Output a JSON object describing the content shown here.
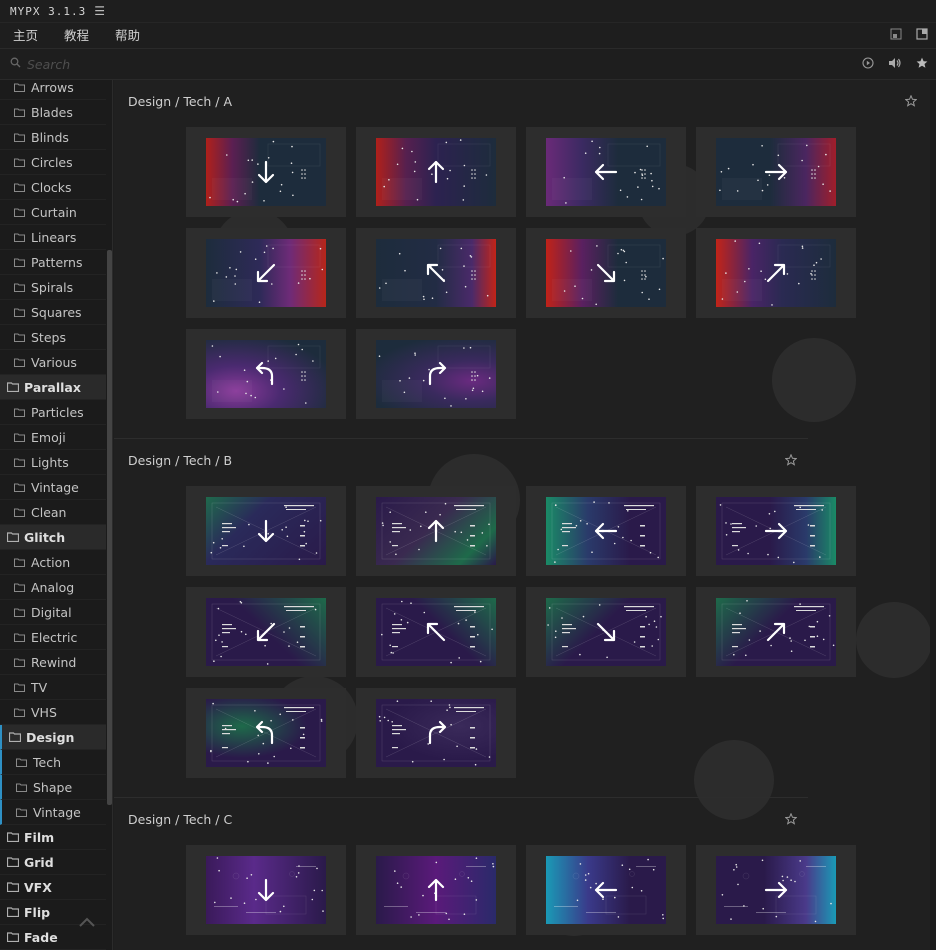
{
  "app": {
    "title": "MYPX 3.1.3"
  },
  "menu": {
    "items": [
      "主页",
      "教程",
      "帮助"
    ]
  },
  "search": {
    "placeholder": "Search",
    "value": ""
  },
  "sidebar": {
    "rows": [
      {
        "label": "Arrows",
        "type": "sub"
      },
      {
        "label": "Blades",
        "type": "sub"
      },
      {
        "label": "Blinds",
        "type": "sub"
      },
      {
        "label": "Circles",
        "type": "sub"
      },
      {
        "label": "Clocks",
        "type": "sub"
      },
      {
        "label": "Curtain",
        "type": "sub"
      },
      {
        "label": "Linears",
        "type": "sub"
      },
      {
        "label": "Patterns",
        "type": "sub"
      },
      {
        "label": "Spirals",
        "type": "sub"
      },
      {
        "label": "Squares",
        "type": "sub"
      },
      {
        "label": "Steps",
        "type": "sub"
      },
      {
        "label": "Various",
        "type": "sub"
      },
      {
        "label": "Parallax",
        "type": "cat",
        "open": true
      },
      {
        "label": "Particles",
        "type": "sub"
      },
      {
        "label": "Emoji",
        "type": "sub"
      },
      {
        "label": "Lights",
        "type": "sub"
      },
      {
        "label": "Vintage",
        "type": "sub"
      },
      {
        "label": "Clean",
        "type": "sub"
      },
      {
        "label": "Glitch",
        "type": "cat",
        "open": true
      },
      {
        "label": "Action",
        "type": "sub"
      },
      {
        "label": "Analog",
        "type": "sub"
      },
      {
        "label": "Digital",
        "type": "sub"
      },
      {
        "label": "Electric",
        "type": "sub"
      },
      {
        "label": "Rewind",
        "type": "sub"
      },
      {
        "label": "TV",
        "type": "sub"
      },
      {
        "label": "VHS",
        "type": "sub"
      },
      {
        "label": "Design",
        "type": "cat",
        "open": true,
        "active": true
      },
      {
        "label": "Tech",
        "type": "sub",
        "active": true
      },
      {
        "label": "Shape",
        "type": "sub",
        "active": true
      },
      {
        "label": "Vintage",
        "type": "sub",
        "active": true
      },
      {
        "label": "Film",
        "type": "cat"
      },
      {
        "label": "Grid",
        "type": "cat"
      },
      {
        "label": "VFX",
        "type": "cat"
      },
      {
        "label": "Flip",
        "type": "cat"
      },
      {
        "label": "Fade",
        "type": "cat"
      }
    ]
  },
  "sections": [
    {
      "title": "Design / Tech / A",
      "style": "a",
      "thumbs": [
        "down",
        "up",
        "left",
        "right",
        "down-left",
        "up-left",
        "down-right",
        "up-right",
        "curve-left",
        "curve-right"
      ]
    },
    {
      "title": "Design / Tech / B",
      "style": "b",
      "thumbs": [
        "down",
        "up",
        "left",
        "right",
        "down-left",
        "up-left",
        "down-right",
        "up-right",
        "curve-left",
        "curve-right"
      ]
    },
    {
      "title": "Design / Tech / C",
      "style": "c",
      "thumbs": [
        "down",
        "up",
        "left",
        "right"
      ]
    }
  ],
  "colors": {
    "accent": "#2e90c4",
    "background": "#1e1e1e",
    "card": "#2d2d2d"
  }
}
